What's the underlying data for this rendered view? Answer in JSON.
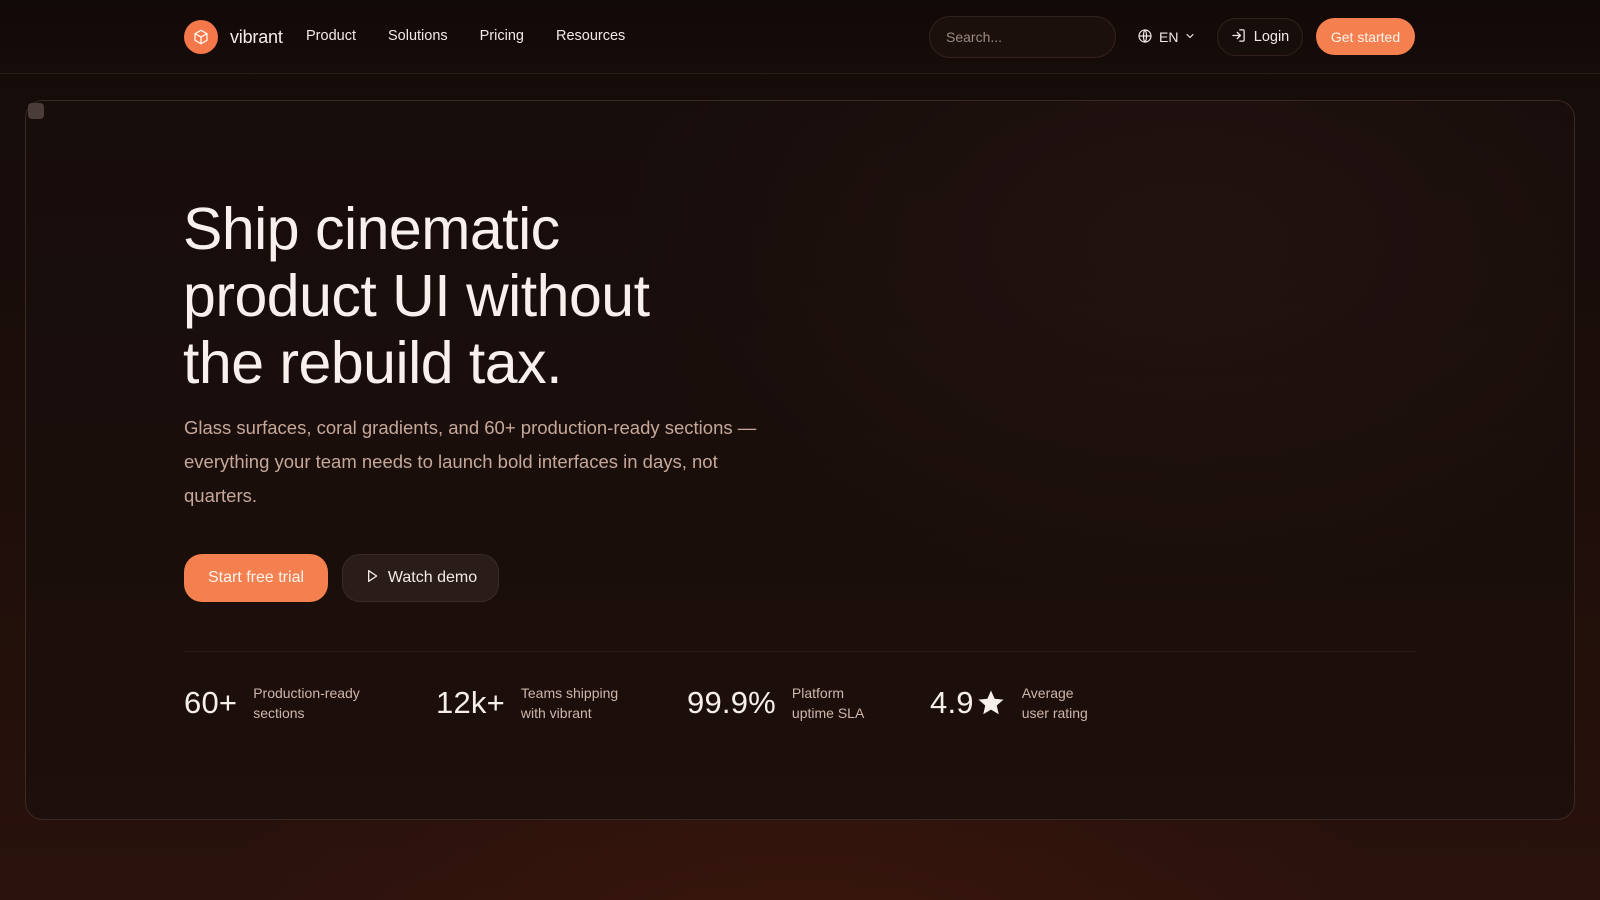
{
  "header": {
    "brand": "vibrant",
    "nav": [
      "Product",
      "Solutions",
      "Pricing",
      "Resources"
    ],
    "search_placeholder": "Search...",
    "language": "EN",
    "login_label": "Login",
    "cta_label": "Get started"
  },
  "hero": {
    "headline_lines": [
      "Ship cinematic",
      "product UI without",
      "the rebuild tax."
    ],
    "subcopy": "Glass surfaces, coral gradients, and 60+ production-ready sections — everything your team needs to launch bold interfaces in days, not quarters.",
    "primary_button": "Start free trial",
    "secondary_button": "Watch demo"
  },
  "stats": [
    {
      "value": "60+",
      "label_lines": [
        "Production-ready",
        "sections"
      ]
    },
    {
      "value": "12k+",
      "label_lines": [
        "Teams shipping",
        "with vibrant"
      ]
    },
    {
      "value": "99.9%",
      "label_lines": [
        "Platform",
        "uptime SLA"
      ]
    },
    {
      "value": "4.9",
      "label_lines": [
        "Average",
        "user rating"
      ]
    }
  ],
  "colors": {
    "accent": "#f4804f",
    "background": "#1a0c09",
    "text_muted": "#c6a89a"
  },
  "icons": [
    "cube-icon",
    "globe-icon",
    "chevron-down-icon",
    "login-icon",
    "play-icon",
    "star-icon"
  ]
}
